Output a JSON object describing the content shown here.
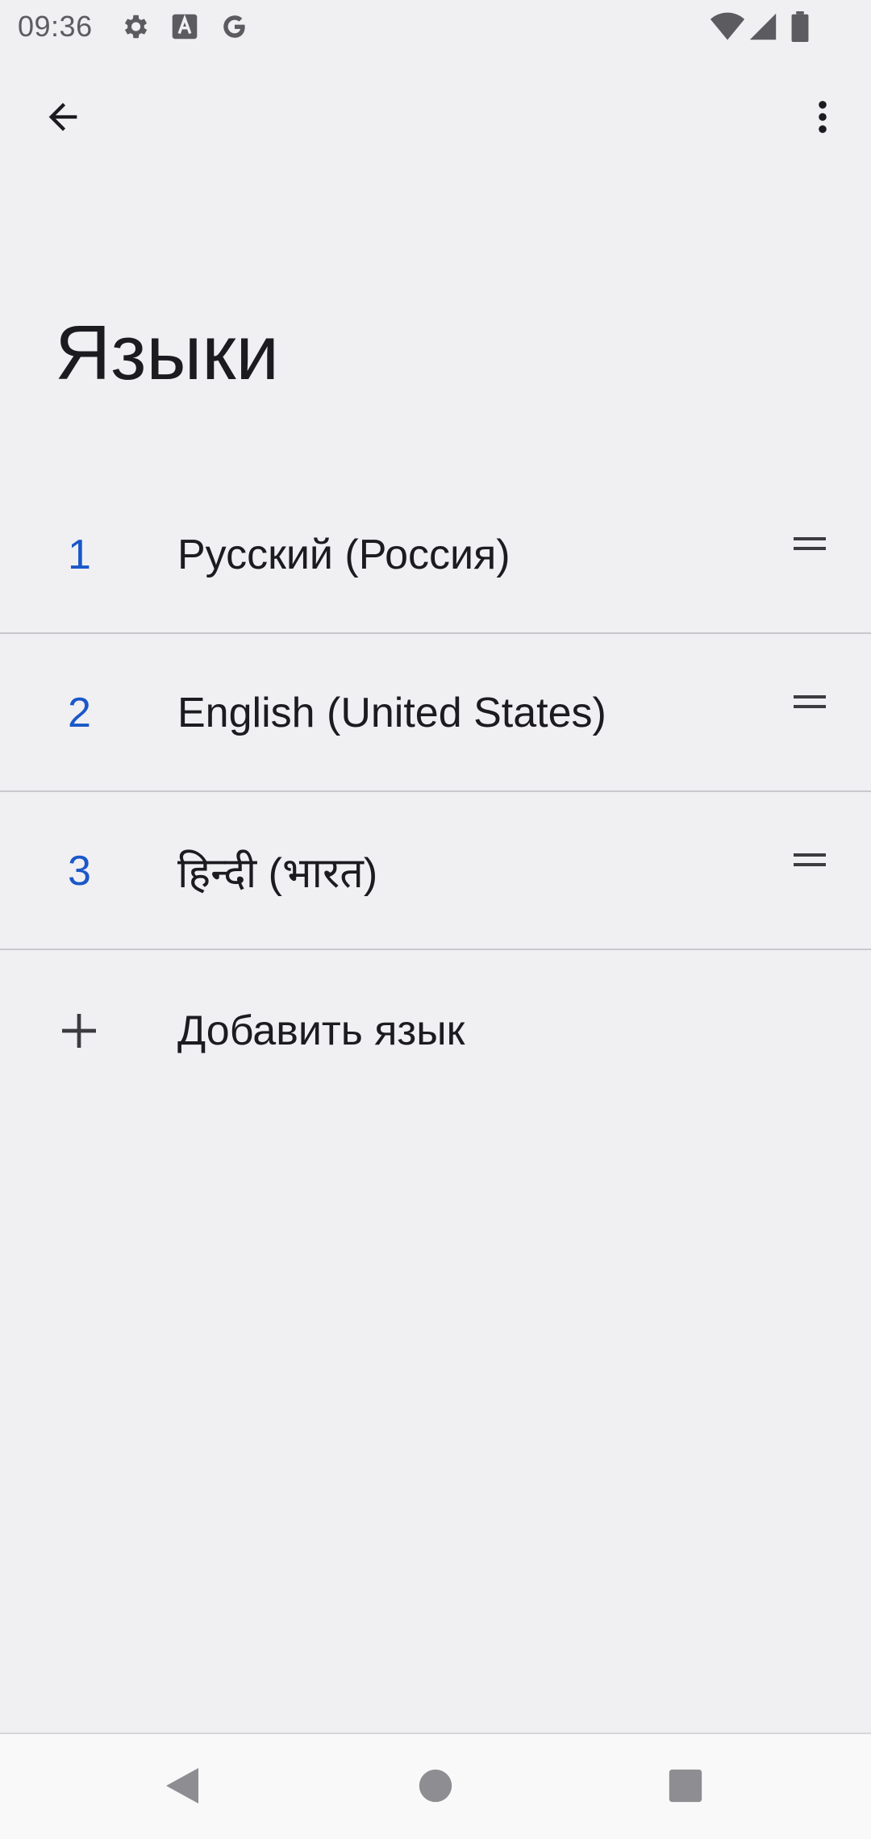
{
  "status_bar": {
    "time": "09:36",
    "icons": [
      "gear-icon",
      "font-a-icon",
      "google-g-icon",
      "wifi-icon",
      "signal-icon",
      "battery-icon"
    ]
  },
  "app_bar": {
    "back_icon": "arrow-back-icon",
    "menu_icon": "more-vert-icon"
  },
  "page": {
    "title": "Языки"
  },
  "languages": [
    {
      "index": "1",
      "name": "Русский (Россия)"
    },
    {
      "index": "2",
      "name": "English (United States)"
    },
    {
      "index": "3",
      "name": "हिन्दी (भारत)"
    }
  ],
  "add_language": {
    "label": "Добавить язык",
    "icon": "plus-icon"
  },
  "nav_bar": {
    "icons": [
      "nav-back-icon",
      "nav-home-icon",
      "nav-recents-icon"
    ]
  },
  "colors": {
    "background": "#f0eff2",
    "accent": "#1a58c8",
    "text": "#1c1b1f",
    "divider": "#c9c8cc"
  }
}
